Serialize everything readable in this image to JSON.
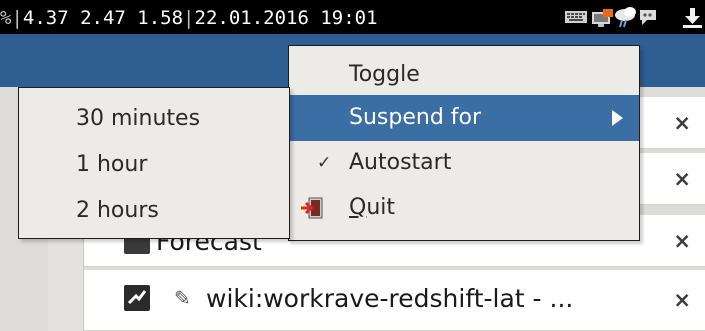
{
  "topbar": {
    "stats_prefix": "%|",
    "load_averages": "4.37 2.47 1.58",
    "separator": "|",
    "datetime": "22.01.2016 19:01",
    "tray_icons": [
      "keyboard-icon",
      "network-icon",
      "weather-icon",
      "chat-icon",
      "download-icon"
    ]
  },
  "context_menu": {
    "items": [
      {
        "label": "Toggle"
      },
      {
        "label": "Suspend for",
        "highlighted": true,
        "has_submenu": true
      },
      {
        "label": "Autostart",
        "checked": true
      },
      {
        "label": "Quit",
        "mnemonic": "Q",
        "rest": "uit",
        "icon": "exit-icon"
      }
    ]
  },
  "submenu": {
    "items": [
      {
        "label": "30 minutes"
      },
      {
        "label": "1 hour"
      },
      {
        "label": "2 hours"
      }
    ]
  },
  "background_list": {
    "items": [
      {
        "label": ""
      },
      {
        "label": ""
      },
      {
        "label": "Forecast"
      },
      {
        "label": "wiki:workrave-redshift-lat - ..."
      }
    ],
    "close_glyph": "×"
  },
  "colors": {
    "highlight": "#3b6ea5",
    "window_title": "#2f5f92",
    "menu_bg": "#ecebe8"
  }
}
